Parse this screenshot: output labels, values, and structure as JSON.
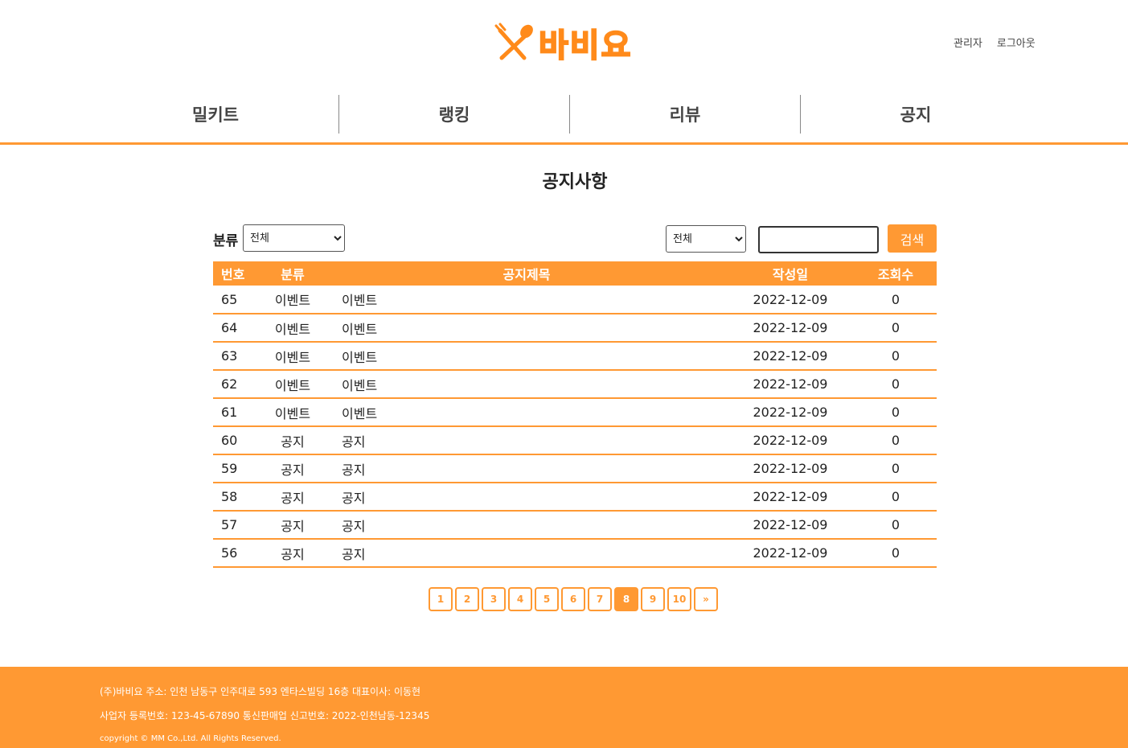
{
  "header": {
    "logo_text": "바비요",
    "links": [
      "관리자",
      "로그아웃"
    ]
  },
  "nav": {
    "items": [
      "밀키트",
      "랭킹",
      "리뷰",
      "공지"
    ]
  },
  "page_title": "공지사항",
  "filter": {
    "category_label": "분류",
    "category_selected": "전체",
    "search_field_selected": "전체",
    "search_value": "",
    "search_button": "검색"
  },
  "table": {
    "headers": {
      "no": "번호",
      "category": "분류",
      "title": "공지제목",
      "date": "작성일",
      "views": "조회수"
    },
    "rows": [
      {
        "no": "65",
        "category": "이벤트",
        "title": "이벤트",
        "date": "2022-12-09",
        "views": "0"
      },
      {
        "no": "64",
        "category": "이벤트",
        "title": "이벤트",
        "date": "2022-12-09",
        "views": "0"
      },
      {
        "no": "63",
        "category": "이벤트",
        "title": "이벤트",
        "date": "2022-12-09",
        "views": "0"
      },
      {
        "no": "62",
        "category": "이벤트",
        "title": "이벤트",
        "date": "2022-12-09",
        "views": "0"
      },
      {
        "no": "61",
        "category": "이벤트",
        "title": "이벤트",
        "date": "2022-12-09",
        "views": "0"
      },
      {
        "no": "60",
        "category": "공지",
        "title": "공지",
        "date": "2022-12-09",
        "views": "0"
      },
      {
        "no": "59",
        "category": "공지",
        "title": "공지",
        "date": "2022-12-09",
        "views": "0"
      },
      {
        "no": "58",
        "category": "공지",
        "title": "공지",
        "date": "2022-12-09",
        "views": "0"
      },
      {
        "no": "57",
        "category": "공지",
        "title": "공지",
        "date": "2022-12-09",
        "views": "0"
      },
      {
        "no": "56",
        "category": "공지",
        "title": "공지",
        "date": "2022-12-09",
        "views": "0"
      }
    ]
  },
  "pagination": {
    "pages": [
      "1",
      "2",
      "3",
      "4",
      "5",
      "6",
      "7",
      "8",
      "9",
      "10"
    ],
    "current": "8",
    "next": "»"
  },
  "footer": {
    "line1": "(주)바비요  주소: 인천 남동구 인주대로 593 엔타스빌딩 16층  대표이사: 이동현",
    "line2": "사업자 등록번호: 123-45-67890  통신판매업 신고번호: 2022-인천남동-12345",
    "line3": "copyright © MM Co.,Ltd. All Rights Reserved."
  },
  "colors": {
    "accent": "#ff9933"
  },
  "icons": {
    "logo": "fork-spoon-icon"
  }
}
